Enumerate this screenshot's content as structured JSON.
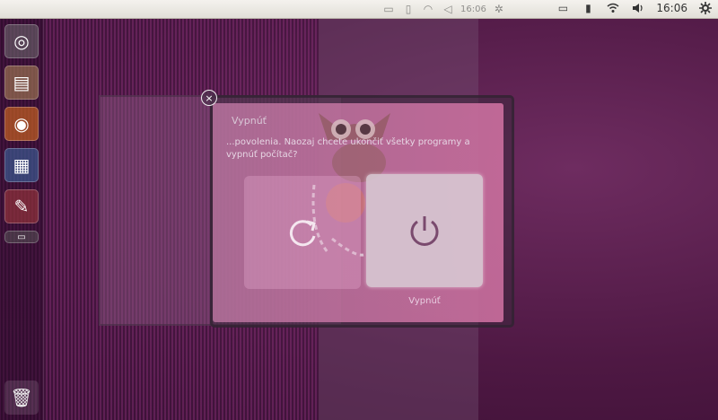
{
  "panel": {
    "clock": "16:06",
    "ghost_clock": "16:06",
    "icons": [
      "battery-icon",
      "wifi-icon",
      "volume-icon",
      "gear-icon"
    ]
  },
  "dialog": {
    "title": "Vypnúť",
    "message": "...povolenia. Naozaj chcete ukončiť všetky programy a vypnúť počítač?",
    "shutdown_label": "Vypnúť"
  }
}
